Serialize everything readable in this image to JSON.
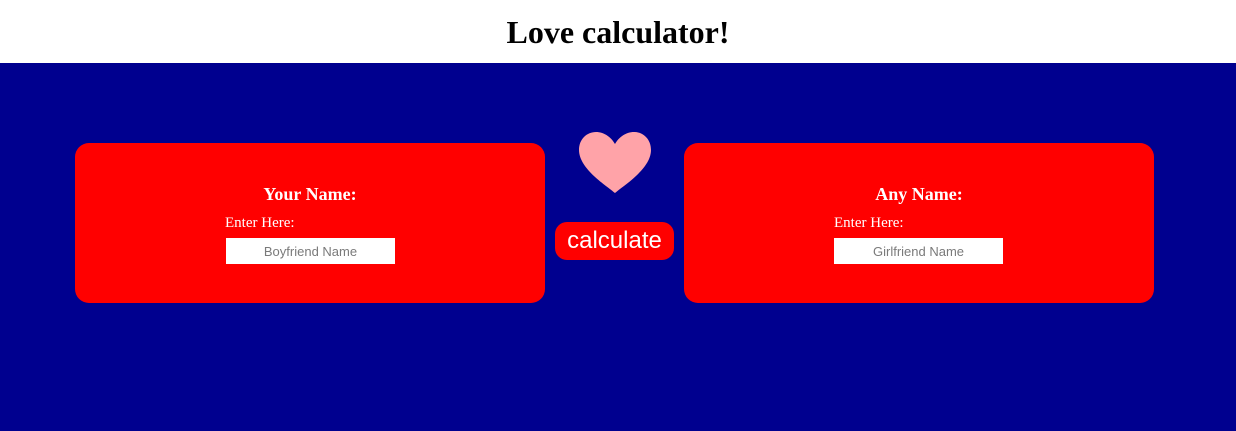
{
  "header": {
    "title": "Love calculator!"
  },
  "left_card": {
    "title": "Your Name:",
    "field_label": "Enter Here:",
    "input_placeholder": "Boyfriend Name",
    "input_value": ""
  },
  "right_card": {
    "title": "Any Name:",
    "field_label": "Enter Here:",
    "input_placeholder": "Girlfriend Name",
    "input_value": ""
  },
  "center": {
    "heart_icon": "heart-icon",
    "button_label": "calculate"
  },
  "colors": {
    "background": "#00008f",
    "card": "#ff0000",
    "heart": "#ffa3a8",
    "header_bg": "#ffffff"
  }
}
